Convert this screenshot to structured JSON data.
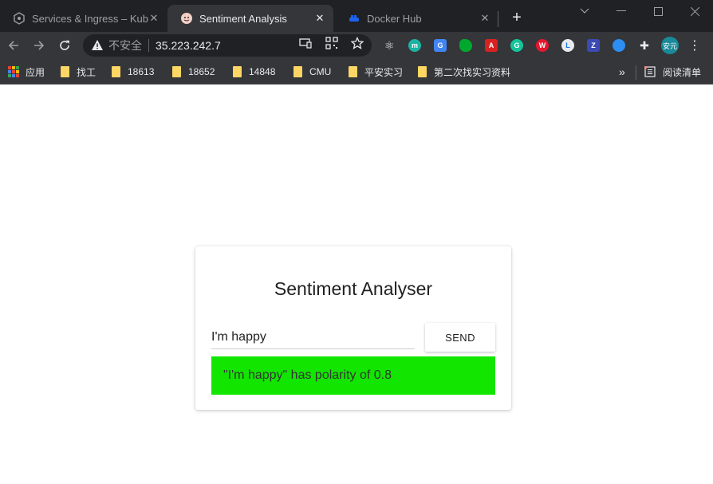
{
  "browser": {
    "tabs": [
      {
        "title": "Services & Ingress – Kub",
        "icon": "kubernetes-icon",
        "active": false
      },
      {
        "title": "Sentiment Analysis",
        "icon": "sentiment-favicon",
        "active": true
      },
      {
        "title": "Docker Hub",
        "icon": "docker-icon",
        "active": false
      }
    ],
    "new_tab": "+",
    "security_label": "不安全",
    "url": "35.223.242.7",
    "profile_label": "安元",
    "extensions": [
      "react-devtools-icon",
      "m-extension-icon",
      "translate-icon",
      "evernote-icon",
      "pdf-icon",
      "grammarly-icon",
      "weibo-icon",
      "clock-icon",
      "zotero-icon",
      "cloud-icon",
      "puzzle-icon"
    ]
  },
  "bookmarks": {
    "items": [
      "应用",
      "找工",
      "18613",
      "18652",
      "14848",
      "CMU",
      "平安实习",
      "第二次找实习资料"
    ],
    "more": "»",
    "reading_list": "阅读清单"
  },
  "app": {
    "title": "Sentiment Analyser",
    "input_value": "I'm happy",
    "send_label": "SEND",
    "result_text": "\"I'm happy\" has polarity of 0.8",
    "result_color": "#12e600"
  }
}
